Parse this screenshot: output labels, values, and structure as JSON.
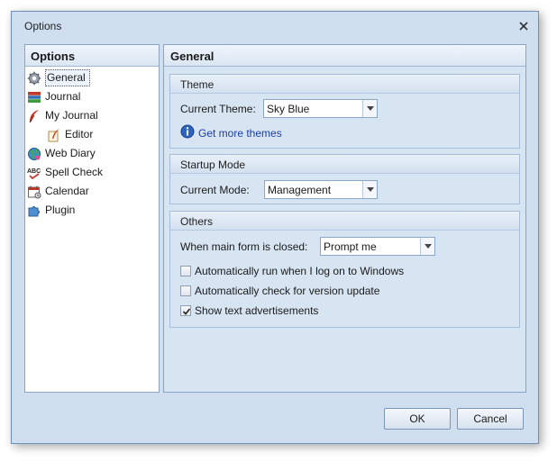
{
  "window": {
    "title": "Options"
  },
  "left_panel": {
    "header": "Options",
    "items": [
      {
        "label": "General",
        "icon": "gear-icon",
        "selected": true
      },
      {
        "label": "Journal",
        "icon": "books-icon"
      },
      {
        "label": "My Journal",
        "icon": "feather-icon"
      },
      {
        "label": "Editor",
        "icon": "pen-icon",
        "indent": true
      },
      {
        "label": "Web Diary",
        "icon": "globe-icon"
      },
      {
        "label": "Spell Check",
        "icon": "spell-check-icon"
      },
      {
        "label": "Calendar",
        "icon": "calendar-icon"
      },
      {
        "label": "Plugin",
        "icon": "puzzle-icon"
      }
    ]
  },
  "right_panel": {
    "header": "General",
    "theme": {
      "header": "Theme",
      "label": "Current Theme:",
      "value": "Sky Blue",
      "link": "Get more themes"
    },
    "startup": {
      "header": "Startup Mode",
      "label": "Current Mode:",
      "value": "Management"
    },
    "others": {
      "header": "Others",
      "closed_label": "When main form is closed:",
      "closed_value": "Prompt me",
      "checks": [
        {
          "label": "Automatically run when I log on to Windows",
          "checked": false
        },
        {
          "label": "Automatically check for version update",
          "checked": false
        },
        {
          "label": "Show text advertisements",
          "checked": true
        }
      ]
    }
  },
  "buttons": {
    "ok": "OK",
    "cancel": "Cancel"
  },
  "colors": {
    "window_bg": "#cfdff0",
    "link": "#1c3fa8",
    "border": "#8aa4c4"
  }
}
